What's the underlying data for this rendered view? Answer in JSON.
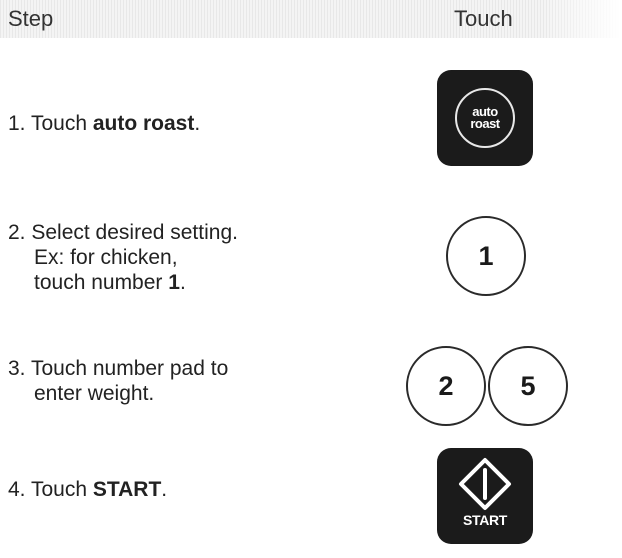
{
  "header": {
    "step_label": "Step",
    "touch_label": "Touch"
  },
  "steps": [
    {
      "line1_prefix": "1. Touch ",
      "line1_bold": "auto roast",
      "line1_suffix": "."
    },
    {
      "line1": "2. Select desired setting.",
      "line2": "Ex: for chicken,",
      "line3_prefix": "touch number ",
      "line3_bold": "1",
      "line3_suffix": "."
    },
    {
      "line1": "3. Touch number pad to",
      "line2": "enter weight."
    },
    {
      "line1_prefix": "4. Touch ",
      "line1_bold": "START",
      "line1_suffix": "."
    }
  ],
  "keys": {
    "auto_roast": {
      "line1": "auto",
      "line2": "roast",
      "icon": "auto-roast-key"
    },
    "number_1": "1",
    "number_2": "2",
    "number_5": "5",
    "start": {
      "label": "START",
      "icon": "start-diamond-icon"
    }
  },
  "colors": {
    "key_background": "#1b1b1b",
    "key_text": "#ffffff",
    "text": "#222222"
  }
}
